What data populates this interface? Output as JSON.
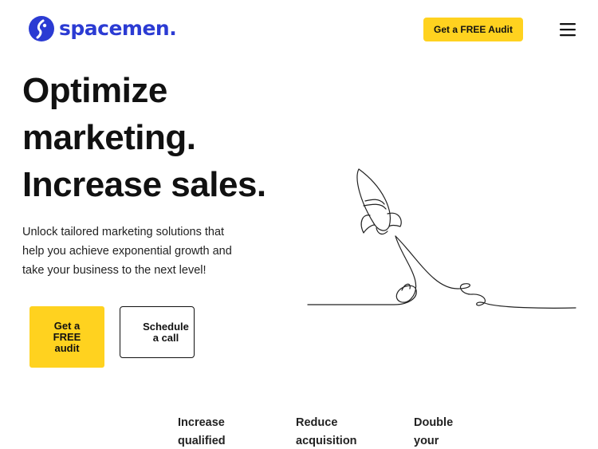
{
  "header": {
    "logo_text": "spacemen.",
    "cta_label": "Get a FREE Audit",
    "menu_icon": "hamburger-menu-icon"
  },
  "hero": {
    "title_lines": [
      "Optimize",
      "marketing.",
      "Increase sales."
    ],
    "subtitle": "Unlock tailored marketing solutions that help you achieve exponential growth and take your business to the next level!",
    "primary_cta": "Get a FREE audit",
    "secondary_cta": "Schedule a call",
    "illustration": "rocket-launch-line-illustration"
  },
  "stats": [
    {
      "label": "Increase qualified"
    },
    {
      "label": "Reduce acquisition"
    },
    {
      "label": "Double your"
    }
  ],
  "colors": {
    "brand_blue": "#2b3bd3",
    "accent_yellow": "#ffd21f",
    "text": "#111111"
  }
}
